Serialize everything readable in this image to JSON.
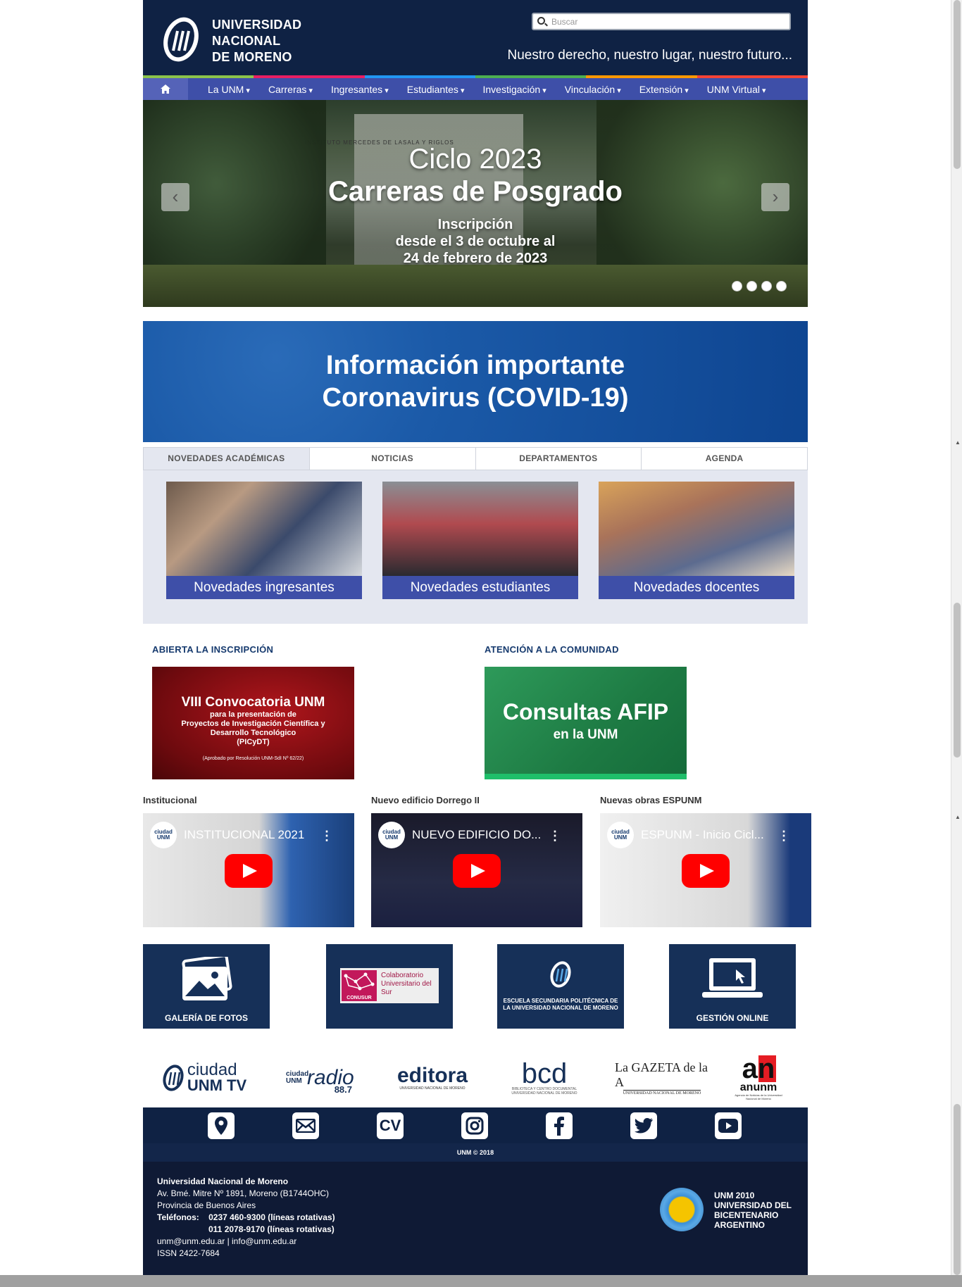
{
  "header": {
    "brand_lines": [
      "UNIVERSIDAD",
      "NACIONAL",
      "DE MORENO"
    ],
    "search_placeholder": "Buscar",
    "motto": "Nuestro derecho, nuestro lugar, nuestro futuro..."
  },
  "strip_colors": [
    "#8bc34a",
    "#e91e63",
    "#2196f3",
    "#4caf50",
    "#ff9800",
    "#f44336"
  ],
  "nav": {
    "home_icon": "home-icon",
    "items": [
      "La UNM",
      "Carreras",
      "Ingresantes",
      "Estudiantes",
      "Investigación",
      "Vinculación",
      "Extensión",
      "UNM Virtual"
    ]
  },
  "slider": {
    "line1": "Ciclo 2023",
    "line2": "Carreras de Posgrado",
    "line3": "Inscripción",
    "line4": "desde el 3 de octubre al",
    "line5": "24 de febrero de 2023",
    "sign": "INSTITUTO MERCEDES DE LASALA Y RIGLOS",
    "prev": "‹",
    "next": "›"
  },
  "covid": {
    "line1": "Información importante",
    "line2": "Coronavirus (COVID-19)"
  },
  "tabs": [
    "NOVEDADES ACADÉMICAS",
    "NOTICIAS",
    "DEPARTAMENTOS",
    "AGENDA"
  ],
  "cards": [
    "Novedades ingresantes",
    "Novedades estudiantes",
    "Novedades docentes"
  ],
  "promos": {
    "left_title": "ABIERTA LA INSCRIPCIÓN",
    "left_l1": "VIII Convocatoria UNM",
    "left_l2": "para la presentación de",
    "left_l3": "Proyectos de Investigación Científica y",
    "left_l4": "Desarrollo Tecnológico",
    "left_l5": "(PICyDT)",
    "left_l6": "(Aprobado por Resolución UNM-SdI Nº 62/22)",
    "right_title": "ATENCIÓN A LA COMUNIDAD",
    "right_l1": "Consultas AFIP",
    "right_l2": "en la UNM"
  },
  "videos": [
    {
      "label": "Institucional",
      "title": "INSTITUCIONAL 2021",
      "channel": "ciudad UNM"
    },
    {
      "label": "Nuevo edificio Dorrego II",
      "title": "NUEVO EDIFICIO DO...",
      "channel": "ciudad UNM"
    },
    {
      "label": "Nuevas obras ESPUNM",
      "title": "ESPUNM - Inicio Cicl...",
      "channel": "ciudad UNM"
    }
  ],
  "tiles": {
    "gallery": "GALERÍA DE FOTOS",
    "conusur_badge": "CONUSUR",
    "conusur_text": "Colaboratorio Universitario del Sur",
    "escuela": "ESCUELA SECUNDARIA POLITÉCNICA DE LA UNIVERSIDAD NACIONAL DE MORENO",
    "gestion": "GESTIÓN ONLINE"
  },
  "logos": {
    "tv1": "ciudad",
    "tv2": "UNM TV",
    "radio1": "ciudad UNM",
    "radio2": "radio",
    "radio3": "88.7",
    "editora": "editora",
    "editora_sub": "UNIVERSIDAD NACIONAL DE MORENO",
    "bcd": "bcd",
    "bcd_sub": "BIBLIOTECA Y CENTRO DOCUMENTAL UNIVERSIDAD NACIONAL DE MORENO",
    "gaceta": "La GAZETA de la A",
    "gaceta_sub": "UNIVERSIDAD NACIONAL DE MORENO",
    "an": "an",
    "anunm": "anunm",
    "an_sub": "Agencia de Noticias de la Universidad Nacional de Moreno"
  },
  "social_icons": [
    "map-pin-icon",
    "mail-icon",
    "cv-icon",
    "instagram-icon",
    "facebook-icon",
    "twitter-icon",
    "youtube-icon"
  ],
  "social_cv": "CV",
  "copyright": "UNM © 2018",
  "footer": {
    "name": "Universidad Nacional de Moreno",
    "addr1": "Av. Bmé. Mitre Nº 1891, Moreno (B1744OHC)",
    "addr2": "Provincia de Buenos Aires",
    "tel_label": "Teléfonos:",
    "tel1": "0237 460-9300 (líneas rotativas)",
    "tel2": "011 2078-9170 (líneas rotativas)",
    "mails": "unm@unm.edu.ar | info@unm.edu.ar",
    "issn": "ISSN 2422-7684",
    "bic1": "UNM 2010",
    "bic2": "UNIVERSIDAD DEL",
    "bic3": "BICENTENARIO",
    "bic4": "ARGENTINO"
  }
}
